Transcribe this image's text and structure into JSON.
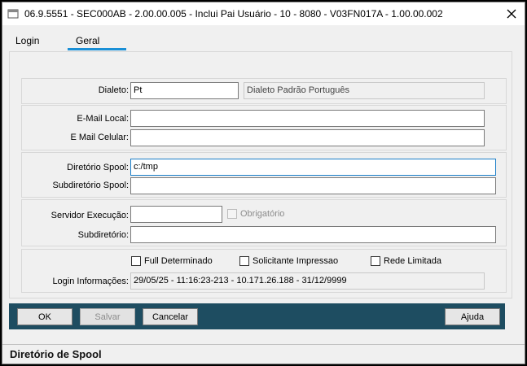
{
  "window": {
    "title": "06.9.5551 - SEC000AB - 2.00.00.005 - Inclui Pai Usuário - 10 - 8080 - V03FN017A - 1.00.00.002"
  },
  "tabs": [
    {
      "label": "Login",
      "active": false
    },
    {
      "label": "Geral",
      "active": true
    }
  ],
  "dialeto": {
    "label": "Dialeto:",
    "value": "Pt",
    "description": "Dialeto Padrão Português"
  },
  "email": {
    "local_label": "E-Mail Local:",
    "local_value": "",
    "celular_label": "E Mail Celular:",
    "celular_value": ""
  },
  "spool": {
    "dir_label": "Diretório Spool:",
    "dir_value": "c:/tmp",
    "subdir_label": "Subdiretório Spool:",
    "subdir_value": ""
  },
  "servidor": {
    "exec_label": "Servidor Execução:",
    "exec_value": "",
    "obrigatorio_label": "Obrigatório",
    "subdir_label": "Subdiretório:",
    "subdir_value": ""
  },
  "opcoes": {
    "full_label": "Full Determinado",
    "solicitante_label": "Solicitante Impressao",
    "rede_label": "Rede Limitada",
    "login_info_label": "Login Informações:",
    "login_info_value": "29/05/25 - 11:16:23-213 - 10.171.26.188 - 31/12/9999"
  },
  "toolbar": {
    "ok_label": "OK",
    "salvar_label": "Salvar",
    "cancelar_label": "Cancelar",
    "ajuda_label": "Ajuda"
  },
  "status": {
    "text": "Diretório de Spool"
  },
  "colors": {
    "toolbar_bg": "#1e4d61",
    "tab_accent": "#1a8fd6",
    "focus_border": "#1a7ec8"
  },
  "icons": {
    "app": "app-window-icon",
    "close": "close-icon"
  }
}
